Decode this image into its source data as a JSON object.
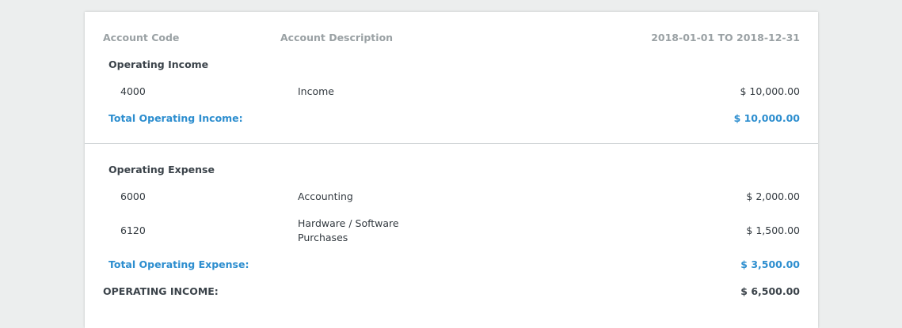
{
  "header": {
    "code_label": "Account Code",
    "description_label": "Account Description",
    "period_label": "2018-01-01 TO 2018-12-31"
  },
  "sections": [
    {
      "title": "Operating Income",
      "rows": [
        {
          "code": "4000",
          "description": "Income",
          "amount": "$ 10,000.00"
        }
      ],
      "total_label": "Total Operating Income:",
      "total_amount": "$ 10,000.00"
    },
    {
      "title": "Operating Expense",
      "rows": [
        {
          "code": "6000",
          "description": "Accounting",
          "amount": "$ 2,000.00"
        },
        {
          "code": "6120",
          "description_line1": "Hardware / Software",
          "description_line2": "Purchases",
          "amount": "$ 1,500.00"
        }
      ],
      "total_label": "Total Operating Expense:",
      "total_amount": "$ 3,500.00"
    }
  ],
  "summary": {
    "label": "OPERATING INCOME:",
    "amount": "$ 6,500.00"
  },
  "colors": {
    "background": "#eceeee",
    "card": "#ffffff",
    "header_text": "#9aa1a4",
    "total_text": "#2d8ecf",
    "body_text": "#333a40"
  }
}
